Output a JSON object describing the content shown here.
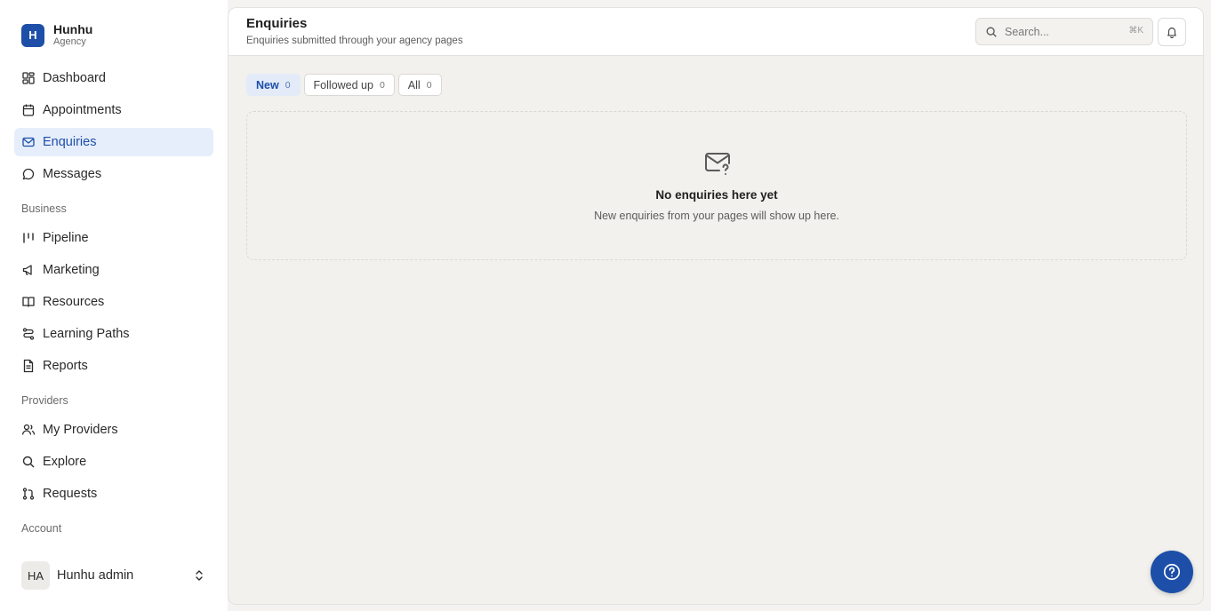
{
  "brand": {
    "logo_letter": "H",
    "name": "Hunhu",
    "subtitle": "Agency"
  },
  "sidebar": {
    "items": [
      {
        "label": "Dashboard",
        "icon": "dashboard-icon"
      },
      {
        "label": "Appointments",
        "icon": "calendar-icon"
      },
      {
        "label": "Enquiries",
        "icon": "mail-icon",
        "active": true
      },
      {
        "label": "Messages",
        "icon": "message-icon"
      }
    ],
    "business_label": "Business",
    "business_items": [
      {
        "label": "Pipeline",
        "icon": "pipeline-icon"
      },
      {
        "label": "Marketing",
        "icon": "megaphone-icon"
      },
      {
        "label": "Resources",
        "icon": "book-icon"
      },
      {
        "label": "Learning Paths",
        "icon": "route-icon"
      },
      {
        "label": "Reports",
        "icon": "report-icon"
      }
    ],
    "providers_label": "Providers",
    "providers_items": [
      {
        "label": "My Providers",
        "icon": "users-icon"
      },
      {
        "label": "Explore",
        "icon": "search-icon"
      },
      {
        "label": "Requests",
        "icon": "pull-request-icon"
      }
    ],
    "account_label": "Account"
  },
  "user": {
    "initials": "HA",
    "name": "Hunhu admin"
  },
  "header": {
    "title": "Enquiries",
    "subtitle": "Enquiries submitted through your agency pages",
    "search_placeholder": "Search...",
    "search_shortcut": "⌘K"
  },
  "tabs": [
    {
      "label": "New",
      "count": "0",
      "active": true
    },
    {
      "label": "Followed up",
      "count": "0"
    },
    {
      "label": "All",
      "count": "0"
    }
  ],
  "empty_state": {
    "title": "No enquiries here yet",
    "description": "New enquiries from your pages will show up here."
  },
  "colors": {
    "accent": "#1d4fa8",
    "active_bg": "#e6eefb",
    "background": "#f2f1ee"
  }
}
